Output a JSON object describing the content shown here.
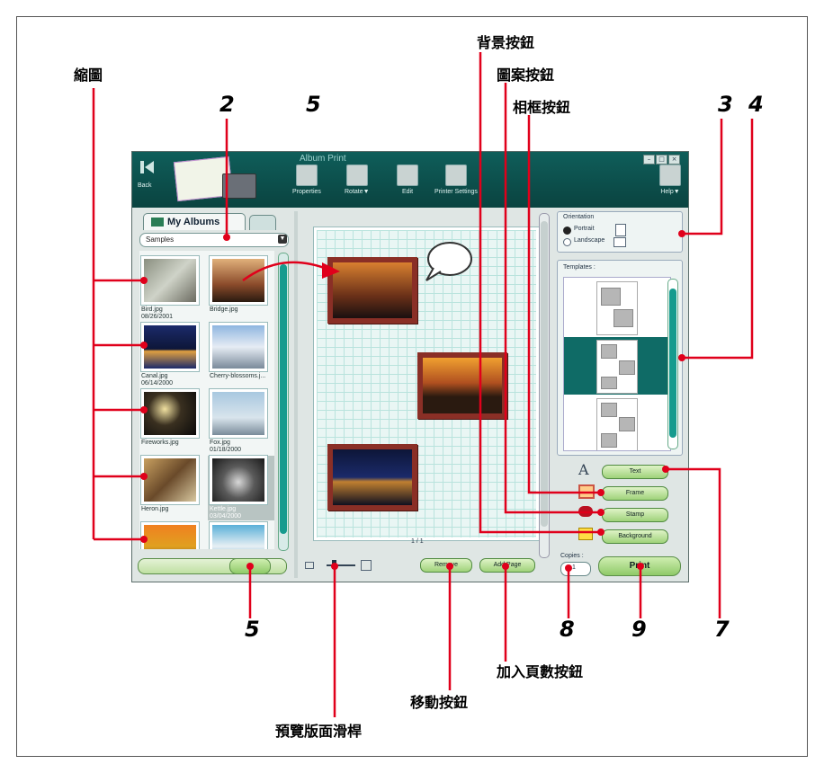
{
  "captions": {
    "thumbnails": "縮圖",
    "background_button": "背景按鈕",
    "stamp_button": "圖案按鈕",
    "frame_button": "相框按鈕",
    "add_page_button": "加入頁數按鈕",
    "move_button": "移動按鈕",
    "preview_slider": "預覽版面滑桿"
  },
  "callout_numbers": {
    "n2": "2",
    "n5_top": "5",
    "n3": "3",
    "n4": "4",
    "n5_bottom": "5",
    "n7": "7",
    "n8": "8",
    "n9": "9"
  },
  "window": {
    "title": "Album Print",
    "back_label": "Back",
    "toolbar": [
      "Properties",
      "Rotate▼",
      "Edit",
      "Printer Settings"
    ],
    "help_label": "Help▼"
  },
  "left_panel": {
    "tab_label": "My Albums",
    "album_select": "Samples",
    "thumbnails": [
      {
        "name": "Bird.jpg",
        "date": "08/26/2001"
      },
      {
        "name": "Bridge.jpg",
        "date": ""
      },
      {
        "name": "Canal.jpg",
        "date": "06/14/2000"
      },
      {
        "name": "Cherry-blossoms.j...",
        "date": ""
      },
      {
        "name": "Fireworks.jpg",
        "date": ""
      },
      {
        "name": "Fox.jpg",
        "date": "01/18/2000"
      },
      {
        "name": "Heron.jpg",
        "date": ""
      },
      {
        "name": "Kettle.jpg",
        "date": "03/04/2000"
      },
      {
        "name": "",
        "date": ""
      },
      {
        "name": "",
        "date": ""
      }
    ]
  },
  "center_panel": {
    "page_indicator": "1 / 1",
    "move_label": "Remove",
    "add_page_label": "Add Page"
  },
  "right_panel": {
    "orientation_title": "Orientation",
    "portrait_label": "Portrait",
    "landscape_label": "Landscape",
    "templates_title": "Templates :",
    "text_button": "Text",
    "frame_button": "Frame",
    "stamp_button": "Stamp",
    "background_button": "Background",
    "copies_label": "Copies :",
    "copies_value": "1",
    "print_label": "Print"
  },
  "colors": {
    "accent_teal": "#0f6b66",
    "callout_red": "#e0001b",
    "photo_frame": "#8a2f26"
  }
}
